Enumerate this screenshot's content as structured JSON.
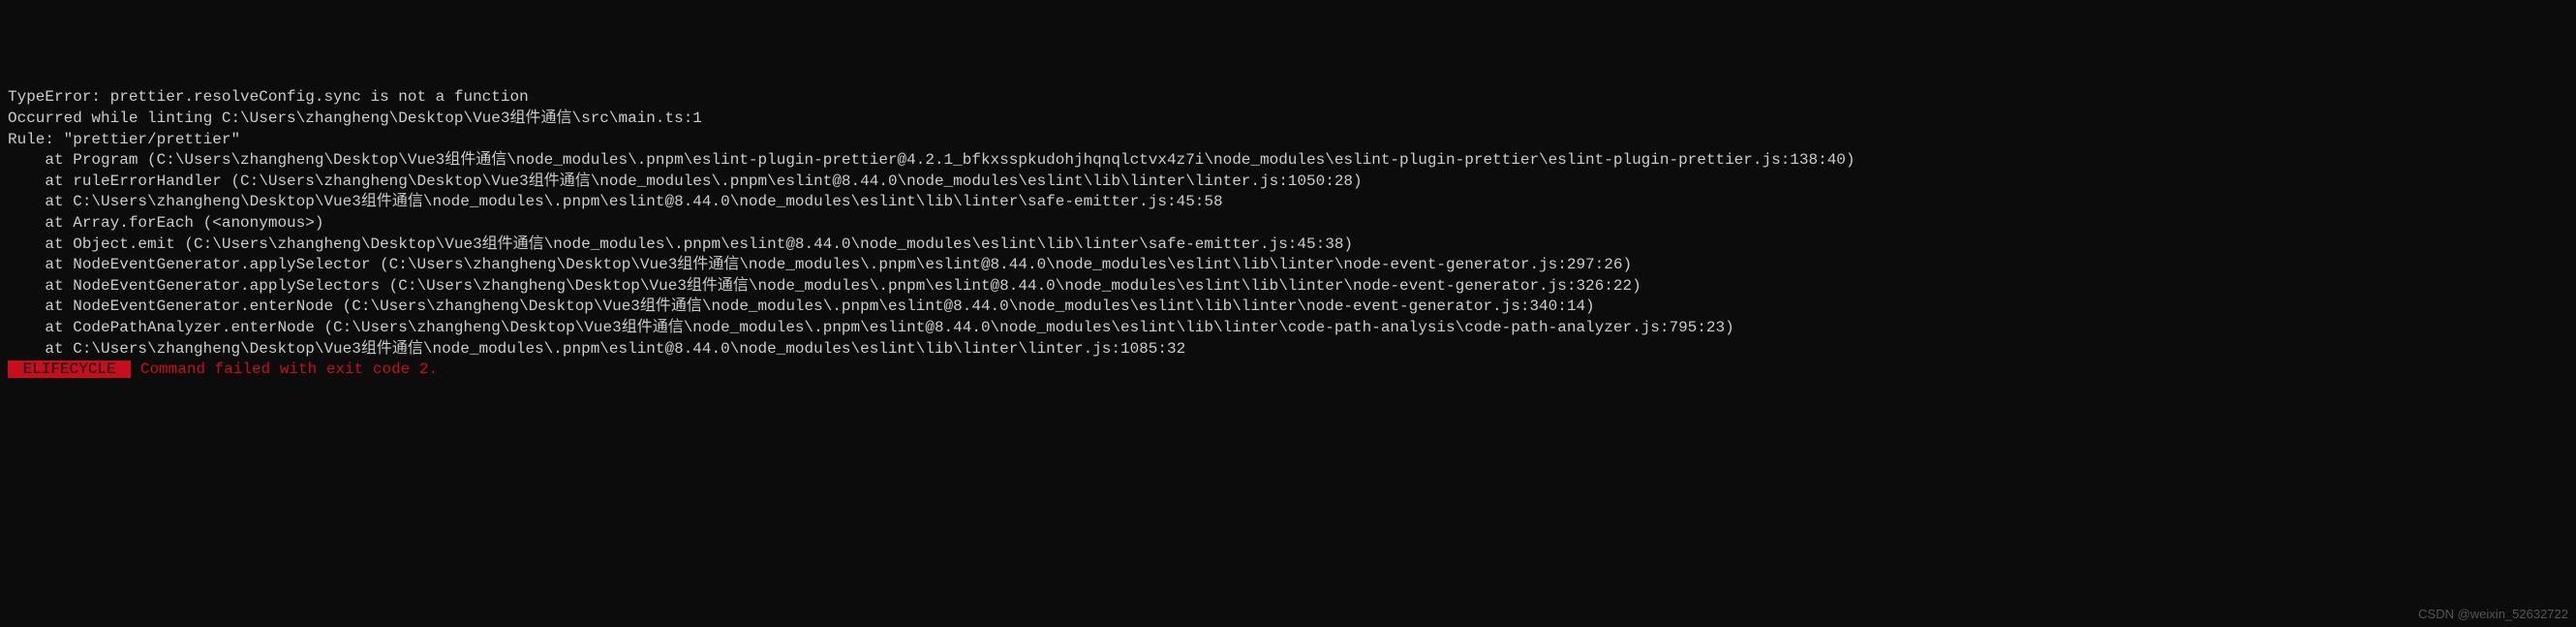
{
  "error": {
    "type": "TypeError: prettier.resolveConfig.sync is not a function",
    "occurred": "Occurred while linting C:\\Users\\zhangheng\\Desktop\\Vue3组件通信\\src\\main.ts:1",
    "rule": "Rule: \"prettier/prettier\"",
    "stack": [
      "    at Program (C:\\Users\\zhangheng\\Desktop\\Vue3组件通信\\node_modules\\.pnpm\\eslint-plugin-prettier@4.2.1_bfkxsspkudohjhqnqlctvx4z7i\\node_modules\\eslint-plugin-prettier\\eslint-plugin-prettier.js:138:40)",
      "    at ruleErrorHandler (C:\\Users\\zhangheng\\Desktop\\Vue3组件通信\\node_modules\\.pnpm\\eslint@8.44.0\\node_modules\\eslint\\lib\\linter\\linter.js:1050:28)",
      "    at C:\\Users\\zhangheng\\Desktop\\Vue3组件通信\\node_modules\\.pnpm\\eslint@8.44.0\\node_modules\\eslint\\lib\\linter\\safe-emitter.js:45:58",
      "    at Array.forEach (<anonymous>)",
      "    at Object.emit (C:\\Users\\zhangheng\\Desktop\\Vue3组件通信\\node_modules\\.pnpm\\eslint@8.44.0\\node_modules\\eslint\\lib\\linter\\safe-emitter.js:45:38)",
      "    at NodeEventGenerator.applySelector (C:\\Users\\zhangheng\\Desktop\\Vue3组件通信\\node_modules\\.pnpm\\eslint@8.44.0\\node_modules\\eslint\\lib\\linter\\node-event-generator.js:297:26)",
      "    at NodeEventGenerator.applySelectors (C:\\Users\\zhangheng\\Desktop\\Vue3组件通信\\node_modules\\.pnpm\\eslint@8.44.0\\node_modules\\eslint\\lib\\linter\\node-event-generator.js:326:22)",
      "    at NodeEventGenerator.enterNode (C:\\Users\\zhangheng\\Desktop\\Vue3组件通信\\node_modules\\.pnpm\\eslint@8.44.0\\node_modules\\eslint\\lib\\linter\\node-event-generator.js:340:14)",
      "    at CodePathAnalyzer.enterNode (C:\\Users\\zhangheng\\Desktop\\Vue3组件通信\\node_modules\\.pnpm\\eslint@8.44.0\\node_modules\\eslint\\lib\\linter\\code-path-analysis\\code-path-analyzer.js:795:23)",
      "    at C:\\Users\\zhangheng\\Desktop\\Vue3组件通信\\node_modules\\.pnpm\\eslint@8.44.0\\node_modules\\eslint\\lib\\linter\\linter.js:1085:32"
    ],
    "lifecycle_badge": " ELIFECYCLE ",
    "lifecycle_message": " Command failed with exit code 2."
  },
  "watermark": "CSDN @weixin_52632722"
}
